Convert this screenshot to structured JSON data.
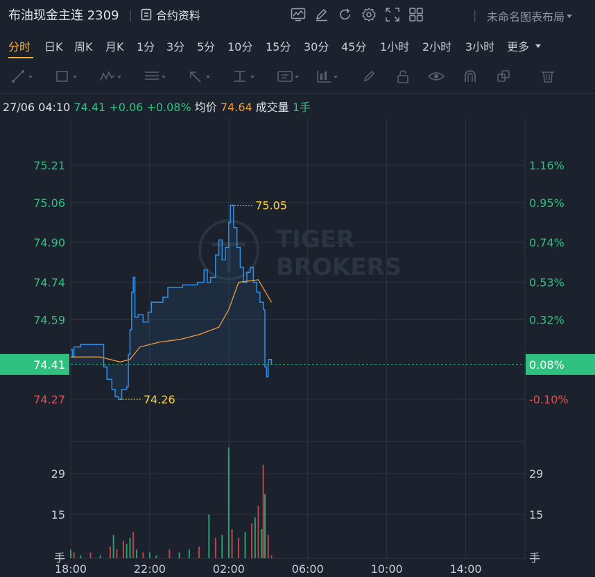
{
  "header": {
    "symbol_title": "布油现金主连 2309",
    "contract_info_label": "合约资料",
    "layout_name": "未命名图表布局"
  },
  "periods": [
    {
      "label": "分时",
      "active": true
    },
    {
      "label": "日K"
    },
    {
      "label": "周K"
    },
    {
      "label": "月K"
    },
    {
      "label": "1分"
    },
    {
      "label": "3分"
    },
    {
      "label": "5分"
    },
    {
      "label": "10分"
    },
    {
      "label": "15分"
    },
    {
      "label": "30分"
    },
    {
      "label": "45分"
    },
    {
      "label": "1小时"
    },
    {
      "label": "2小时"
    },
    {
      "label": "3小时"
    }
  ],
  "more_label": "更多",
  "info": {
    "datetime": "27/06 04:10",
    "price": "74.41",
    "change": "+0.06",
    "change_pct": "+0.08%",
    "avg_label": "均价",
    "avg_value": "74.64",
    "volume_label": "成交量",
    "volume_value": "1手"
  },
  "watermark": {
    "line1": "TIGER",
    "line2": "BROKERS"
  },
  "colors": {
    "background": "#1b222d",
    "up": "#2fc17f",
    "down": "#e0534e",
    "price_line": "#2e8fe6",
    "avg_line": "#f29b38",
    "annotation": "#f4d54a"
  },
  "chart_data": {
    "type": "line",
    "x_ticks": [
      "18:00",
      "22:00",
      "02:00",
      "06:00",
      "10:00",
      "14:00"
    ],
    "price_axis": {
      "left_ticks": [
        "75.21",
        "75.06",
        "74.90",
        "74.74",
        "74.59",
        "74.41",
        "74.27"
      ],
      "right_ticks": [
        "1.16%",
        "0.95%",
        "0.74%",
        "0.53%",
        "0.32%",
        "0.08%",
        "-0.10%"
      ],
      "tick_values": [
        75.21,
        75.06,
        74.9,
        74.74,
        74.59,
        74.41,
        74.27
      ],
      "ylim": [
        74.1,
        75.4
      ],
      "reference_price": 74.35,
      "current_price": 74.41
    },
    "high_label": "75.05",
    "low_label": "74.26",
    "time_range": [
      "18:00",
      "17:00"
    ],
    "price_series": [
      [
        "18:00",
        74.47
      ],
      [
        "18:05",
        74.44
      ],
      [
        "18:10",
        74.48
      ],
      [
        "18:30",
        74.49
      ],
      [
        "19:00",
        74.49
      ],
      [
        "19:35",
        74.49
      ],
      [
        "19:40",
        74.4
      ],
      [
        "19:50",
        74.35
      ],
      [
        "20:05",
        74.31
      ],
      [
        "20:15",
        74.28
      ],
      [
        "20:25",
        74.27
      ],
      [
        "20:35",
        74.31
      ],
      [
        "20:50",
        74.32
      ],
      [
        "20:55",
        74.45
      ],
      [
        "21:00",
        74.55
      ],
      [
        "21:05",
        74.7
      ],
      [
        "21:10",
        74.76
      ],
      [
        "21:15",
        74.6
      ],
      [
        "21:25",
        74.61
      ],
      [
        "21:40",
        74.58
      ],
      [
        "21:55",
        74.62
      ],
      [
        "22:05",
        74.66
      ],
      [
        "22:25",
        74.66
      ],
      [
        "22:40",
        74.68
      ],
      [
        "22:55",
        74.72
      ],
      [
        "23:20",
        74.72
      ],
      [
        "23:40",
        74.73
      ],
      [
        "00:00",
        74.73
      ],
      [
        "00:25",
        74.74
      ],
      [
        "00:45",
        74.79
      ],
      [
        "00:55",
        74.74
      ],
      [
        "01:05",
        74.76
      ],
      [
        "01:20",
        74.85
      ],
      [
        "01:30",
        74.91
      ],
      [
        "01:40",
        74.83
      ],
      [
        "01:50",
        74.88
      ],
      [
        "02:00",
        74.98
      ],
      [
        "02:05",
        75.05
      ],
      [
        "02:15",
        74.96
      ],
      [
        "02:25",
        74.88
      ],
      [
        "02:35",
        74.8
      ],
      [
        "02:45",
        74.74
      ],
      [
        "02:55",
        74.78
      ],
      [
        "03:05",
        74.8
      ],
      [
        "03:15",
        74.74
      ],
      [
        "03:25",
        74.7
      ],
      [
        "03:35",
        74.66
      ],
      [
        "03:45",
        74.63
      ],
      [
        "03:50",
        74.4
      ],
      [
        "03:55",
        74.36
      ],
      [
        "04:00",
        74.43
      ],
      [
        "04:10",
        74.41
      ]
    ],
    "avg_series": [
      [
        "18:00",
        74.44
      ],
      [
        "19:30",
        74.44
      ],
      [
        "20:00",
        74.43
      ],
      [
        "20:30",
        74.42
      ],
      [
        "21:00",
        74.43
      ],
      [
        "21:30",
        74.48
      ],
      [
        "22:30",
        74.5
      ],
      [
        "23:30",
        74.51
      ],
      [
        "00:30",
        74.53
      ],
      [
        "01:30",
        74.56
      ],
      [
        "02:00",
        74.63
      ],
      [
        "02:30",
        74.74
      ],
      [
        "03:30",
        74.75
      ],
      [
        "04:10",
        74.66
      ]
    ],
    "volume": {
      "y_ticks": [
        29,
        15
      ],
      "ylim": [
        0,
        40
      ],
      "y_unit_label": "手",
      "bars": [
        [
          "18:00",
          3,
          "up"
        ],
        [
          "18:10",
          2,
          "down"
        ],
        [
          "18:30",
          1,
          "up"
        ],
        [
          "19:00",
          2,
          "down"
        ],
        [
          "19:30",
          1,
          "up"
        ],
        [
          "20:00",
          4,
          "down"
        ],
        [
          "20:10",
          8,
          "up"
        ],
        [
          "20:20",
          3,
          "down"
        ],
        [
          "20:40",
          6,
          "down"
        ],
        [
          "20:50",
          5,
          "up"
        ],
        [
          "21:00",
          7,
          "up"
        ],
        [
          "21:10",
          9,
          "down"
        ],
        [
          "21:20",
          3,
          "up"
        ],
        [
          "21:40",
          2,
          "down"
        ],
        [
          "22:00",
          2,
          "up"
        ],
        [
          "22:20",
          1,
          "up"
        ],
        [
          "23:00",
          3,
          "down"
        ],
        [
          "23:30",
          2,
          "up"
        ],
        [
          "00:00",
          3,
          "up"
        ],
        [
          "00:30",
          4,
          "down"
        ],
        [
          "01:00",
          15,
          "up"
        ],
        [
          "01:20",
          7,
          "down"
        ],
        [
          "01:40",
          8,
          "up"
        ],
        [
          "02:00",
          38,
          "up"
        ],
        [
          "02:10",
          10,
          "down"
        ],
        [
          "02:30",
          7,
          "down"
        ],
        [
          "02:50",
          9,
          "up"
        ],
        [
          "03:10",
          12,
          "down"
        ],
        [
          "03:20",
          14,
          "up"
        ],
        [
          "03:30",
          18,
          "down"
        ],
        [
          "03:40",
          10,
          "up"
        ],
        [
          "03:45",
          32,
          "down"
        ],
        [
          "03:50",
          22,
          "up"
        ],
        [
          "04:00",
          8,
          "down"
        ],
        [
          "04:10",
          1,
          "down"
        ]
      ]
    }
  }
}
